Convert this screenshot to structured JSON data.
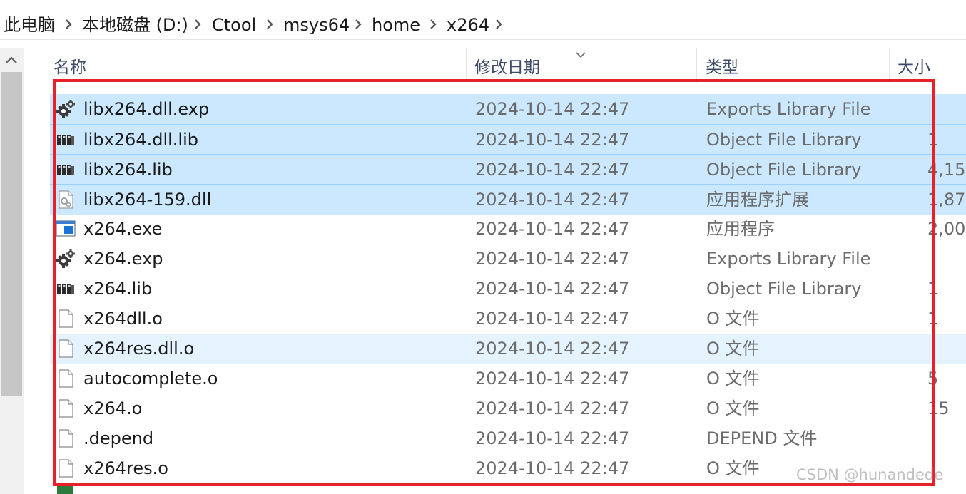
{
  "breadcrumb": [
    "此电脑",
    "本地磁盘 (D:)",
    "Ctool",
    "msys64",
    "home",
    "x264"
  ],
  "columns": {
    "name": "名称",
    "date": "修改日期",
    "type": "类型",
    "size": "大小"
  },
  "files": [
    {
      "name": "libx264.dll.exp",
      "date": "2024-10-14 22:47",
      "type": "Exports Library File",
      "size": "",
      "icon": "exports-library-icon",
      "state": "selected"
    },
    {
      "name": "libx264.dll.lib",
      "date": "2024-10-14 22:47",
      "type": "Object File Library",
      "size": "1",
      "icon": "object-library-icon",
      "state": "selected"
    },
    {
      "name": "libx264.lib",
      "date": "2024-10-14 22:47",
      "type": "Object File Library",
      "size": "4,15",
      "icon": "object-library-icon",
      "state": "selected"
    },
    {
      "name": "libx264-159.dll",
      "date": "2024-10-14 22:47",
      "type": "应用程序扩展",
      "size": "1,87",
      "icon": "dll-icon",
      "state": "selected"
    },
    {
      "name": "x264.exe",
      "date": "2024-10-14 22:47",
      "type": "应用程序",
      "size": "2,00",
      "icon": "exe-icon",
      "state": "normal"
    },
    {
      "name": "x264.exp",
      "date": "2024-10-14 22:47",
      "type": "Exports Library File",
      "size": "",
      "icon": "exports-library-icon",
      "state": "normal"
    },
    {
      "name": "x264.lib",
      "date": "2024-10-14 22:47",
      "type": "Object File Library",
      "size": "1",
      "icon": "object-library-icon",
      "state": "normal"
    },
    {
      "name": "x264dll.o",
      "date": "2024-10-14 22:47",
      "type": "O 文件",
      "size": "1",
      "icon": "blank-file-icon",
      "state": "normal"
    },
    {
      "name": "x264res.dll.o",
      "date": "2024-10-14 22:47",
      "type": "O 文件",
      "size": "",
      "icon": "blank-file-icon",
      "state": "hover"
    },
    {
      "name": "autocomplete.o",
      "date": "2024-10-14 22:47",
      "type": "O 文件",
      "size": "5",
      "icon": "blank-file-icon",
      "state": "normal"
    },
    {
      "name": "x264.o",
      "date": "2024-10-14 22:47",
      "type": "O 文件",
      "size": "15",
      "icon": "blank-file-icon",
      "state": "normal"
    },
    {
      "name": ".depend",
      "date": "2024-10-14 22:47",
      "type": "DEPEND 文件",
      "size": "",
      "icon": "blank-file-icon",
      "state": "normal"
    },
    {
      "name": "x264res.o",
      "date": "2024-10-14 22:47",
      "type": "O 文件",
      "size": "",
      "icon": "blank-file-icon",
      "state": "normal"
    }
  ],
  "watermark": "CSDN @hunandede",
  "colors": {
    "selected": "#cce8ff",
    "hover": "#e5f3ff",
    "highlight_box": "#e8202a"
  }
}
